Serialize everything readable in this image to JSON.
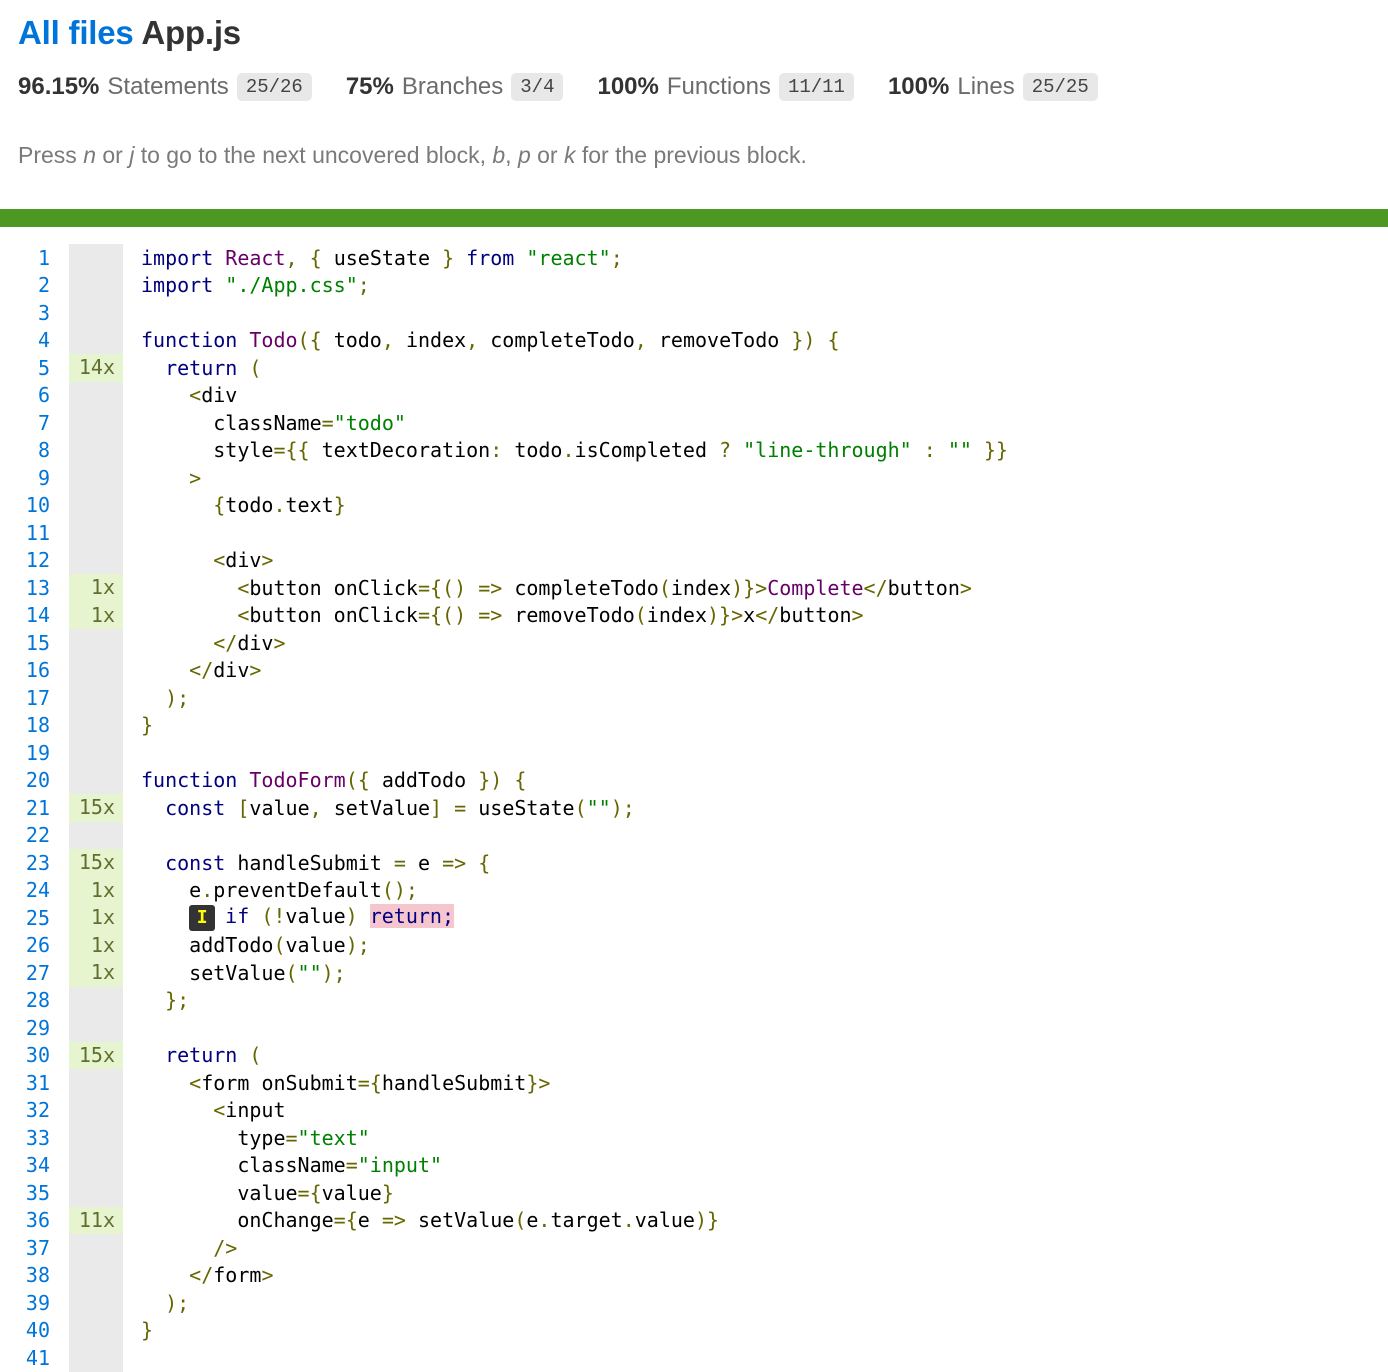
{
  "header": {
    "all_files": "All files",
    "file_name": "App.js"
  },
  "stats": [
    {
      "pct": "96.15%",
      "label": "Statements",
      "fraction": "25/26"
    },
    {
      "pct": "75%",
      "label": "Branches",
      "fraction": "3/4"
    },
    {
      "pct": "100%",
      "label": "Functions",
      "fraction": "11/11"
    },
    {
      "pct": "100%",
      "label": "Lines",
      "fraction": "25/25"
    }
  ],
  "help": {
    "press": "Press ",
    "n": "n",
    "or1": " or ",
    "j": "j",
    "mid": " to go to the next uncovered block, ",
    "b": "b",
    "comma": ", ",
    "p": "p",
    "or2": " or ",
    "k": "k",
    "end": " for the previous block."
  },
  "colors": {
    "status_bar": "#4d9822",
    "link": "#0074d9",
    "covered_bg": "#e6f5d0",
    "uncovered_bg": "#f6c6ce"
  },
  "branch_marker": "I",
  "code_lines": [
    {
      "n": "1",
      "hit": "",
      "code": "import React, { useState } from \"react\";"
    },
    {
      "n": "2",
      "hit": "",
      "code": "import \"./App.css\";"
    },
    {
      "n": "3",
      "hit": "",
      "code": ""
    },
    {
      "n": "4",
      "hit": "",
      "code": "function Todo({ todo, index, completeTodo, removeTodo }) {"
    },
    {
      "n": "5",
      "hit": "14x",
      "code": "  return ("
    },
    {
      "n": "6",
      "hit": "",
      "code": "    <div"
    },
    {
      "n": "7",
      "hit": "",
      "code": "      className=\"todo\""
    },
    {
      "n": "8",
      "hit": "",
      "code": "      style={{ textDecoration: todo.isCompleted ? \"line-through\" : \"\" }}"
    },
    {
      "n": "9",
      "hit": "",
      "code": "    >"
    },
    {
      "n": "10",
      "hit": "",
      "code": "      {todo.text}"
    },
    {
      "n": "11",
      "hit": "",
      "code": ""
    },
    {
      "n": "12",
      "hit": "",
      "code": "      <div>"
    },
    {
      "n": "13",
      "hit": "1x",
      "code": "        <button onClick={() => completeTodo(index)}>Complete</button>"
    },
    {
      "n": "14",
      "hit": "1x",
      "code": "        <button onClick={() => removeTodo(index)}>x</button>"
    },
    {
      "n": "15",
      "hit": "",
      "code": "      </div>"
    },
    {
      "n": "16",
      "hit": "",
      "code": "    </div>"
    },
    {
      "n": "17",
      "hit": "",
      "code": "  );"
    },
    {
      "n": "18",
      "hit": "",
      "code": "}"
    },
    {
      "n": "19",
      "hit": "",
      "code": ""
    },
    {
      "n": "20",
      "hit": "",
      "code": "function TodoForm({ addTodo }) {"
    },
    {
      "n": "21",
      "hit": "15x",
      "code": "  const [value, setValue] = useState(\"\");"
    },
    {
      "n": "22",
      "hit": "",
      "code": ""
    },
    {
      "n": "23",
      "hit": "15x",
      "code": "  const handleSubmit = e => {"
    },
    {
      "n": "24",
      "hit": "1x",
      "code": "    e.preventDefault();"
    },
    {
      "n": "25",
      "hit": "1x",
      "code": "if (!value) ",
      "uncovered": "return;"
    },
    {
      "n": "26",
      "hit": "1x",
      "code": "    addTodo(value);"
    },
    {
      "n": "27",
      "hit": "1x",
      "code": "    setValue(\"\");"
    },
    {
      "n": "28",
      "hit": "",
      "code": "  };"
    },
    {
      "n": "29",
      "hit": "",
      "code": ""
    },
    {
      "n": "30",
      "hit": "15x",
      "code": "  return ("
    },
    {
      "n": "31",
      "hit": "",
      "code": "    <form onSubmit={handleSubmit}>"
    },
    {
      "n": "32",
      "hit": "",
      "code": "      <input"
    },
    {
      "n": "33",
      "hit": "",
      "code": "        type=\"text\""
    },
    {
      "n": "34",
      "hit": "",
      "code": "        className=\"input\""
    },
    {
      "n": "35",
      "hit": "",
      "code": "        value={value}"
    },
    {
      "n": "36",
      "hit": "11x",
      "code": "        onChange={e => setValue(e.target.value)}"
    },
    {
      "n": "37",
      "hit": "",
      "code": "      />"
    },
    {
      "n": "38",
      "hit": "",
      "code": "    </form>"
    },
    {
      "n": "39",
      "hit": "",
      "code": "  );"
    },
    {
      "n": "40",
      "hit": "",
      "code": "}"
    },
    {
      "n": "41",
      "hit": "",
      "code": ""
    }
  ]
}
